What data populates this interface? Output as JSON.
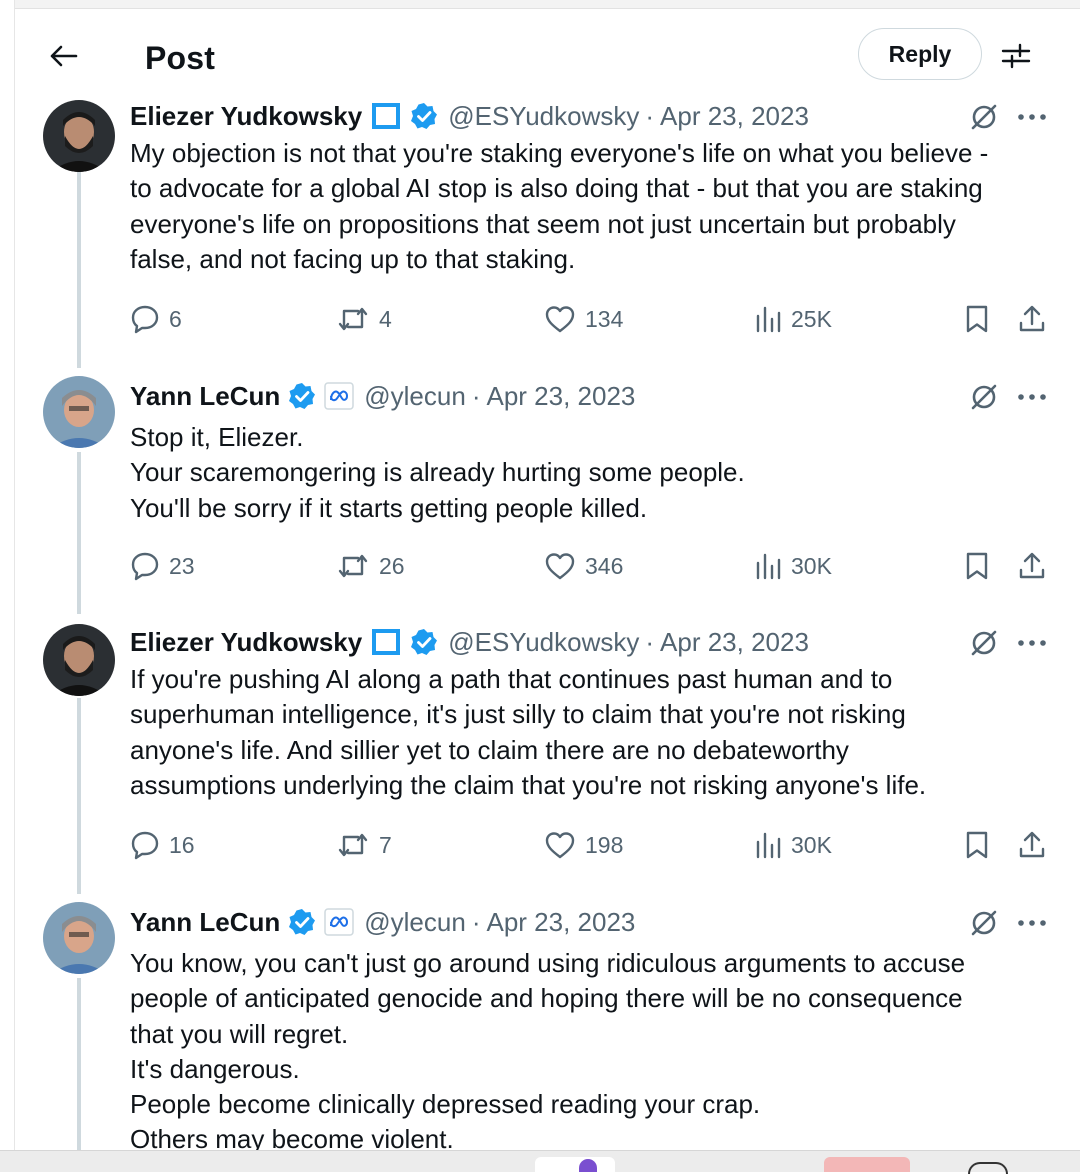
{
  "header": {
    "title": "Post",
    "reply_label": "Reply"
  },
  "icons": {
    "back": "arrow-left-icon",
    "settings": "sliders-icon",
    "reply": "speech-bubble-icon",
    "repost": "repost-arrows-icon",
    "like": "heart-icon",
    "views": "bar-chart-icon",
    "bookmark": "bookmark-icon",
    "share": "share-upload-icon",
    "grok": "slashed-circle-icon",
    "more": "ellipsis-icon"
  },
  "colors": {
    "verified_blue": "#1d9bf0",
    "text_primary": "#0f1419",
    "text_secondary": "#536471",
    "thread_line": "#cfd9de"
  },
  "tweets": [
    {
      "author": "Eliezer Yudkowsky",
      "handle": "@ESYudkowsky",
      "separator": "·",
      "date": "Apr 23, 2023",
      "badges": [
        "square-badge-icon",
        "verified-badge-icon"
      ],
      "lines": [
        "My objection is not that you're staking everyone's life on what you believe -",
        "to advocate for a global AI stop is also doing that - but that you are staking",
        "everyone's life on propositions that seem not just uncertain but probably",
        "false, and not facing up to that staking."
      ],
      "stats": {
        "replies": "6",
        "reposts": "4",
        "likes": "134",
        "views": "25K"
      }
    },
    {
      "author": "Yann LeCun",
      "handle": "@ylecun",
      "separator": "·",
      "date": "Apr 23, 2023",
      "badges": [
        "verified-badge-icon",
        "meta-affiliate-icon"
      ],
      "lines": [
        "Stop it, Eliezer.",
        "Your scaremongering is already hurting some people.",
        "You'll be sorry if it starts getting people killed."
      ],
      "stats": {
        "replies": "23",
        "reposts": "26",
        "likes": "346",
        "views": "30K"
      }
    },
    {
      "author": "Eliezer Yudkowsky",
      "handle": "@ESYudkowsky",
      "separator": "·",
      "date": "Apr 23, 2023",
      "badges": [
        "square-badge-icon",
        "verified-badge-icon"
      ],
      "lines": [
        "If you're pushing AI along a path that continues past human and to",
        "superhuman intelligence, it's just silly to claim that you're not risking",
        "anyone's life.  And sillier yet to claim there are no debateworthy",
        "assumptions underlying the claim that you're not risking anyone's life."
      ],
      "stats": {
        "replies": "16",
        "reposts": "7",
        "likes": "198",
        "views": "30K"
      }
    },
    {
      "author": "Yann LeCun",
      "handle": "@ylecun",
      "separator": "·",
      "date": "Apr 23, 2023",
      "badges": [
        "verified-badge-icon",
        "meta-affiliate-icon"
      ],
      "lines": [
        "You know, you can't just go around using ridiculous arguments to accuse",
        "people of anticipated genocide  and hoping there will be no consequence",
        "that you will regret.",
        "It's dangerous.",
        "People become clinically depressed reading your crap.",
        "Others may become violent."
      ]
    }
  ]
}
